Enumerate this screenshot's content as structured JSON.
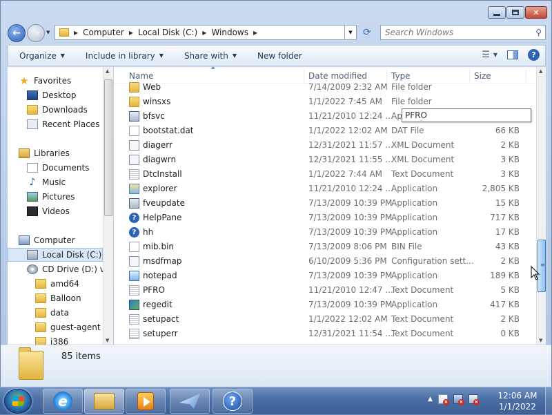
{
  "window": {
    "caption_buttons": [
      "minimize",
      "maximize",
      "close"
    ]
  },
  "address": {
    "path": [
      "Computer",
      "Local Disk (C:)",
      "Windows"
    ],
    "search_placeholder": "Search Windows"
  },
  "commandbar": {
    "organize": "Organize",
    "include_in_library": "Include in library",
    "share_with": "Share with",
    "new_folder": "New folder"
  },
  "nav": {
    "favorites": "Favorites",
    "desktop": "Desktop",
    "downloads": "Downloads",
    "recent_places": "Recent Places",
    "libraries": "Libraries",
    "documents": "Documents",
    "music": "Music",
    "pictures": "Pictures",
    "videos": "Videos",
    "computer": "Computer",
    "local_disk": "Local Disk (C:)",
    "cd_drive": "CD Drive (D:) virt",
    "folders": [
      "amd64",
      "Balloon",
      "data",
      "guest-agent",
      "i386"
    ]
  },
  "columns": {
    "name": "Name",
    "date_modified": "Date modified",
    "type": "Type",
    "size": "Size"
  },
  "files": [
    {
      "name": "Web",
      "date": "7/14/2009 2:32 AM",
      "type": "File folder",
      "size": "",
      "icon": "folder-icon"
    },
    {
      "name": "winsxs",
      "date": "1/1/2022 7:45 AM",
      "type": "File folder",
      "size": "",
      "icon": "folder-icon"
    },
    {
      "name": "bfsvc",
      "date": "11/21/2010 12:24 ...",
      "type": "Ap",
      "size": "",
      "icon": "application-icon"
    },
    {
      "name": "bootstat.dat",
      "date": "1/1/2022 12:02 AM",
      "type": "DAT File",
      "size": "66 KB",
      "icon": "file-icon"
    },
    {
      "name": "diagerr",
      "date": "12/31/2021 11:57 ...",
      "type": "XML Document",
      "size": "2 KB",
      "icon": "xml-icon"
    },
    {
      "name": "diagwrn",
      "date": "12/31/2021 11:55 ...",
      "type": "XML Document",
      "size": "3 KB",
      "icon": "xml-icon"
    },
    {
      "name": "DtcInstall",
      "date": "1/1/2022 7:44 AM",
      "type": "Text Document",
      "size": "3 KB",
      "icon": "text-document-icon"
    },
    {
      "name": "explorer",
      "date": "11/21/2010 12:24 ...",
      "type": "Application",
      "size": "2,805 KB",
      "icon": "explorer-icon"
    },
    {
      "name": "fveupdate",
      "date": "7/13/2009 10:39 PM",
      "type": "Application",
      "size": "15 KB",
      "icon": "application-icon"
    },
    {
      "name": "HelpPane",
      "date": "7/13/2009 10:39 PM",
      "type": "Application",
      "size": "717 KB",
      "icon": "help-icon"
    },
    {
      "name": "hh",
      "date": "7/13/2009 10:39 PM",
      "type": "Application",
      "size": "17 KB",
      "icon": "help-icon"
    },
    {
      "name": "mib.bin",
      "date": "7/13/2009 8:06 PM",
      "type": "BIN File",
      "size": "43 KB",
      "icon": "file-icon"
    },
    {
      "name": "msdfmap",
      "date": "6/10/2009 5:36 PM",
      "type": "Configuration sett...",
      "size": "2 KB",
      "icon": "config-icon"
    },
    {
      "name": "notepad",
      "date": "7/13/2009 10:39 PM",
      "type": "Application",
      "size": "189 KB",
      "icon": "notepad-icon"
    },
    {
      "name": "PFRO",
      "date": "11/21/2010 12:47 ...",
      "type": "Text Document",
      "size": "5 KB",
      "icon": "text-document-icon"
    },
    {
      "name": "regedit",
      "date": "7/13/2009 10:39 PM",
      "type": "Application",
      "size": "417 KB",
      "icon": "regedit-icon"
    },
    {
      "name": "setupact",
      "date": "1/1/2022 12:02 AM",
      "type": "Text Document",
      "size": "2 KB",
      "icon": "text-document-icon"
    },
    {
      "name": "setuperr",
      "date": "12/31/2021 11:54 ...",
      "type": "Text Document",
      "size": "0 KB",
      "icon": "text-document-icon"
    }
  ],
  "tooltip": "PFRO",
  "details": {
    "item_count": "85 items"
  },
  "taskbar": {
    "time": "12:06 AM",
    "date": "1/1/2022",
    "pinned": [
      "internet-explorer",
      "windows-explorer",
      "media-player",
      "send-app",
      "help-and-support"
    ]
  }
}
